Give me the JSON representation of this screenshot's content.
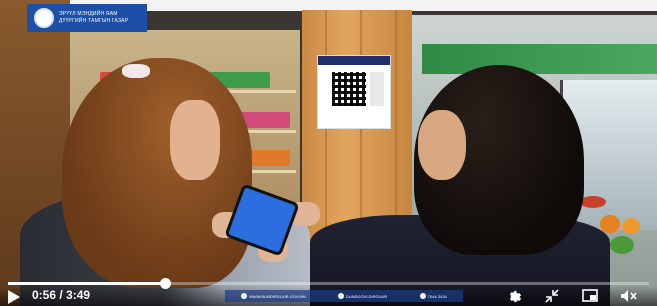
{
  "logo": {
    "line1": "ЭРҮҮЛ МЭНДИЙН ЯАМ",
    "line2": "ДҮҮРГИЙН ТАМГЫН ГАЗАР"
  },
  "qr_card": {
    "header": "QPAY"
  },
  "player": {
    "current_time": "0:56",
    "duration": "3:49",
    "time_display": "0:56 / 3:49",
    "progress_fraction": 0.245
  },
  "info_strip": {
    "website": "WWW.BUNDIRGUUR.GOV.MN",
    "facebook": "DUNDGOVI.DIRGUUR",
    "phone": "7044-3434"
  },
  "icons": {
    "play": "play-icon",
    "settings": "gear-icon",
    "fullscreen_exit": "fullscreen-exit-icon",
    "pip": "picture-in-picture-icon",
    "mute": "volume-muted-icon"
  }
}
